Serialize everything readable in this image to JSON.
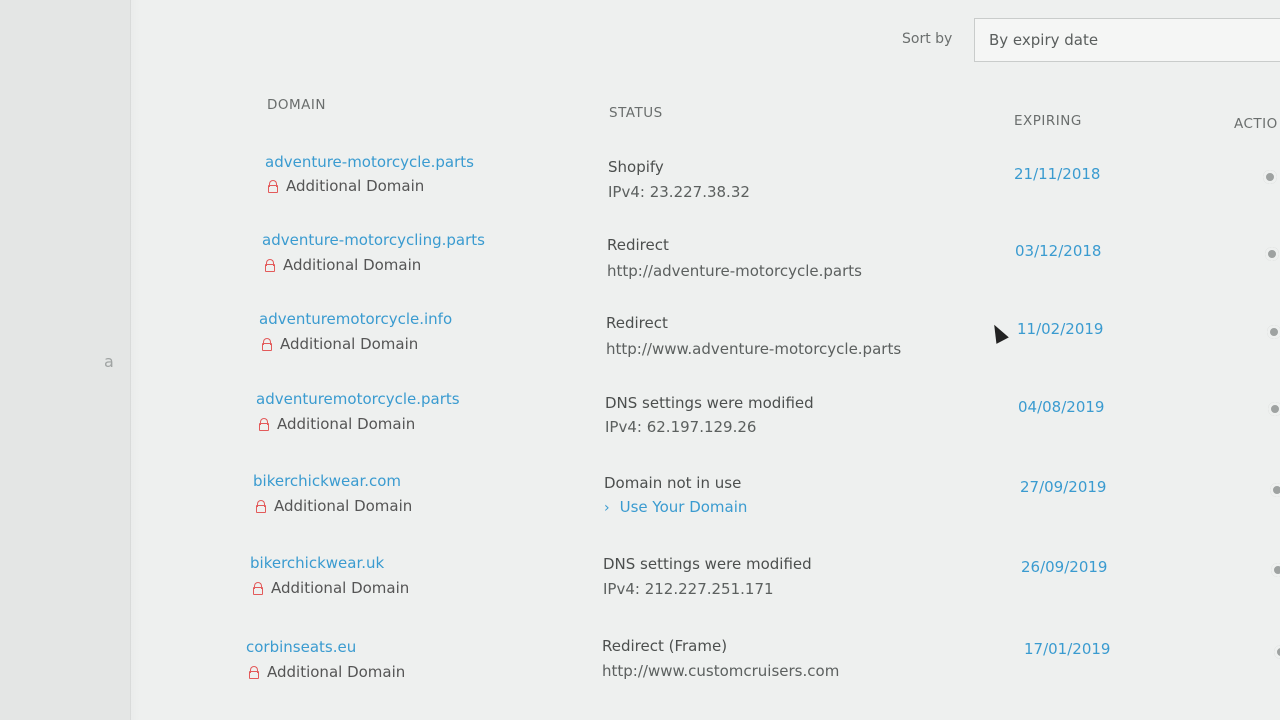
{
  "sort": {
    "label": "Sort by",
    "selected": "By expiry date"
  },
  "columns": {
    "domain": "DOMAIN",
    "status": "STATUS",
    "expiring": "EXPIRING",
    "actions": "ACTIO"
  },
  "rows": [
    {
      "domain": "adventure-motorcycle.parts",
      "type": "Additional Domain",
      "status": "Shopify",
      "detail": "IPv4: 23.227.38.32",
      "expiry": "21/11/2018"
    },
    {
      "domain": "adventure-motorcycling.parts",
      "type": "Additional Domain",
      "status": "Redirect",
      "detail": "http://adventure-motorcycle.parts",
      "expiry": "03/12/2018"
    },
    {
      "domain": "adventuremotorcycle.info",
      "type": "Additional Domain",
      "status": "Redirect",
      "detail": "http://www.adventure-motorcycle.parts",
      "expiry": "11/02/2019"
    },
    {
      "domain": "adventuremotorcycle.parts",
      "type": "Additional Domain",
      "status": "DNS settings were modified",
      "detail": "IPv4: 62.197.129.26",
      "expiry": "04/08/2019"
    },
    {
      "domain": "bikerchickwear.com",
      "type": "Additional Domain",
      "status": "Domain not in use",
      "detail": "Use Your Domain",
      "expiry": "27/09/2019"
    },
    {
      "domain": "bikerchickwear.uk",
      "type": "Additional Domain",
      "status": "DNS settings were modified",
      "detail": "IPv4: 212.227.251.171",
      "expiry": "26/09/2019"
    },
    {
      "domain": "corbinseats.eu",
      "type": "Additional Domain",
      "status": "Redirect (Frame)",
      "detail": "http://www.customcruisers.com",
      "expiry": "17/01/2019"
    }
  ],
  "colors": {
    "link": "#3a9bd0",
    "lock": "#e35a5a",
    "text": "#4c4f4e"
  }
}
